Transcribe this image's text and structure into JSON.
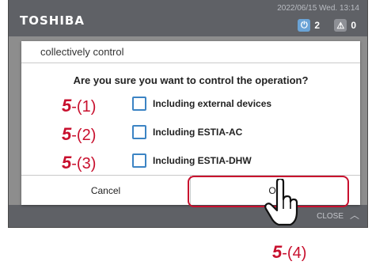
{
  "header": {
    "brand": "TOSHIBA",
    "datetime": "2022/06/15 Wed. 13:14",
    "power_count": "2",
    "alarm_count": "0"
  },
  "footer": {
    "close_label": "CLOSE"
  },
  "dialog": {
    "title": "collectively control",
    "question": "Are you sure you want to control the operation?",
    "options": [
      {
        "label": "Including external devices",
        "checked": false
      },
      {
        "label": "Including ESTIA-AC",
        "checked": false
      },
      {
        "label": "Including ESTIA-DHW",
        "checked": false
      }
    ],
    "cancel_label": "Cancel",
    "ok_label": "OK"
  },
  "annotations": [
    {
      "num": "5",
      "sub": "-(1)"
    },
    {
      "num": "5",
      "sub": "-(2)"
    },
    {
      "num": "5",
      "sub": "-(3)"
    },
    {
      "num": "5",
      "sub": "-(4)"
    }
  ],
  "colors": {
    "accent_red": "#c8102e",
    "checkbox_blue": "#3c84c4",
    "bar": "#5f6166",
    "overlay": "#8d8d8d"
  },
  "icons": {
    "power": "power-icon",
    "alarm": "warning-icon",
    "close_chevron": "chevron-up-icon",
    "pointer": "hand-pointer-icon"
  }
}
